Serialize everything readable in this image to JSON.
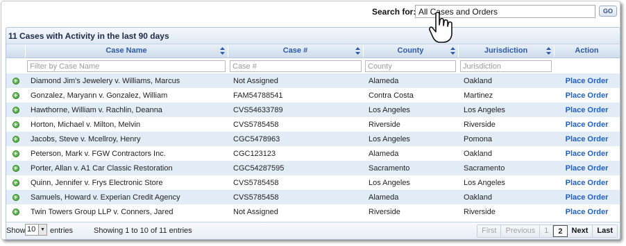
{
  "search": {
    "label": "Search for:",
    "value": "All Cases and Orders",
    "go_label": "GO"
  },
  "panel": {
    "title": "11 Cases with Activity in the last 90 days"
  },
  "table": {
    "columns": [
      "Case Name",
      "Case #",
      "County",
      "Jurisdiction",
      "Action"
    ],
    "filters": {
      "case_name": "Filter by Case Name",
      "case_number": "Case #",
      "county": "County",
      "jurisdiction": "Jurisdiction"
    },
    "rows": [
      {
        "name": "Diamond Jim's Jewelery v. Williams, Marcus",
        "number": "Not Assigned",
        "county": "Alameda",
        "jurisdiction": "Oakland",
        "action": "Place Order"
      },
      {
        "name": "Gonzalez, Maryann v. Gonzalez, William",
        "number": "FAM54788541",
        "county": "Contra Costa",
        "jurisdiction": "Martinez",
        "action": "Place Order"
      },
      {
        "name": "Hawthorne, William v. Rachlin, Deanna",
        "number": "CVS54633789",
        "county": "Los Angeles",
        "jurisdiction": "Los Angeles",
        "action": "Place Order"
      },
      {
        "name": "Horton, Michael v. Milton, Melvin",
        "number": "CVS5785458",
        "county": "Riverside",
        "jurisdiction": "Riverside",
        "action": "Place Order"
      },
      {
        "name": "Jacobs, Steve v. Mcellroy, Henry",
        "number": "CGC5478963",
        "county": "Los Angeles",
        "jurisdiction": "Pomona",
        "action": "Place Order"
      },
      {
        "name": "Peterson, Mark v. FGW Contractors Inc.",
        "number": "CGC123123",
        "county": "Alameda",
        "jurisdiction": "Oakland",
        "action": "Place Order"
      },
      {
        "name": "Porter, Allan v. A1 Car Classic Restoration",
        "number": "CGC54287595",
        "county": "Sacramento",
        "jurisdiction": "Sacramento",
        "action": "Place Order"
      },
      {
        "name": "Quinn, Jennifer v. Frys Electronic Store",
        "number": "CVS5785458",
        "county": "Los Angeles",
        "jurisdiction": "Los Angeles",
        "action": "Place Order"
      },
      {
        "name": "Samuels, Howard v. Experian Credit Agency",
        "number": "CVS5785458",
        "county": "Alameda",
        "jurisdiction": "Oakland",
        "action": "Place Order"
      },
      {
        "name": "Twin Towers Group LLP v. Conners, Jared",
        "number": "Not Assigned",
        "county": "Riverside",
        "jurisdiction": "Riverside",
        "action": "Place Order"
      }
    ]
  },
  "footer": {
    "show_label": "Show",
    "page_length": "10",
    "entries_label": "entries",
    "info": "Showing 1 to 10 of 11 entries",
    "pager": {
      "first": "First",
      "previous": "Previous",
      "pages": [
        "1",
        "2"
      ],
      "next": "Next",
      "last": "Last"
    }
  },
  "icons": {
    "expand_row": "plus-circle-icon",
    "sort": "sort-arrows-icon",
    "cursor": "hand-pointer-icon"
  },
  "colors": {
    "link": "#1f5fbf",
    "header_text": "#2a5aa8",
    "row_alt": "#e2ecf6",
    "expand_green": "#2f9a2a"
  }
}
